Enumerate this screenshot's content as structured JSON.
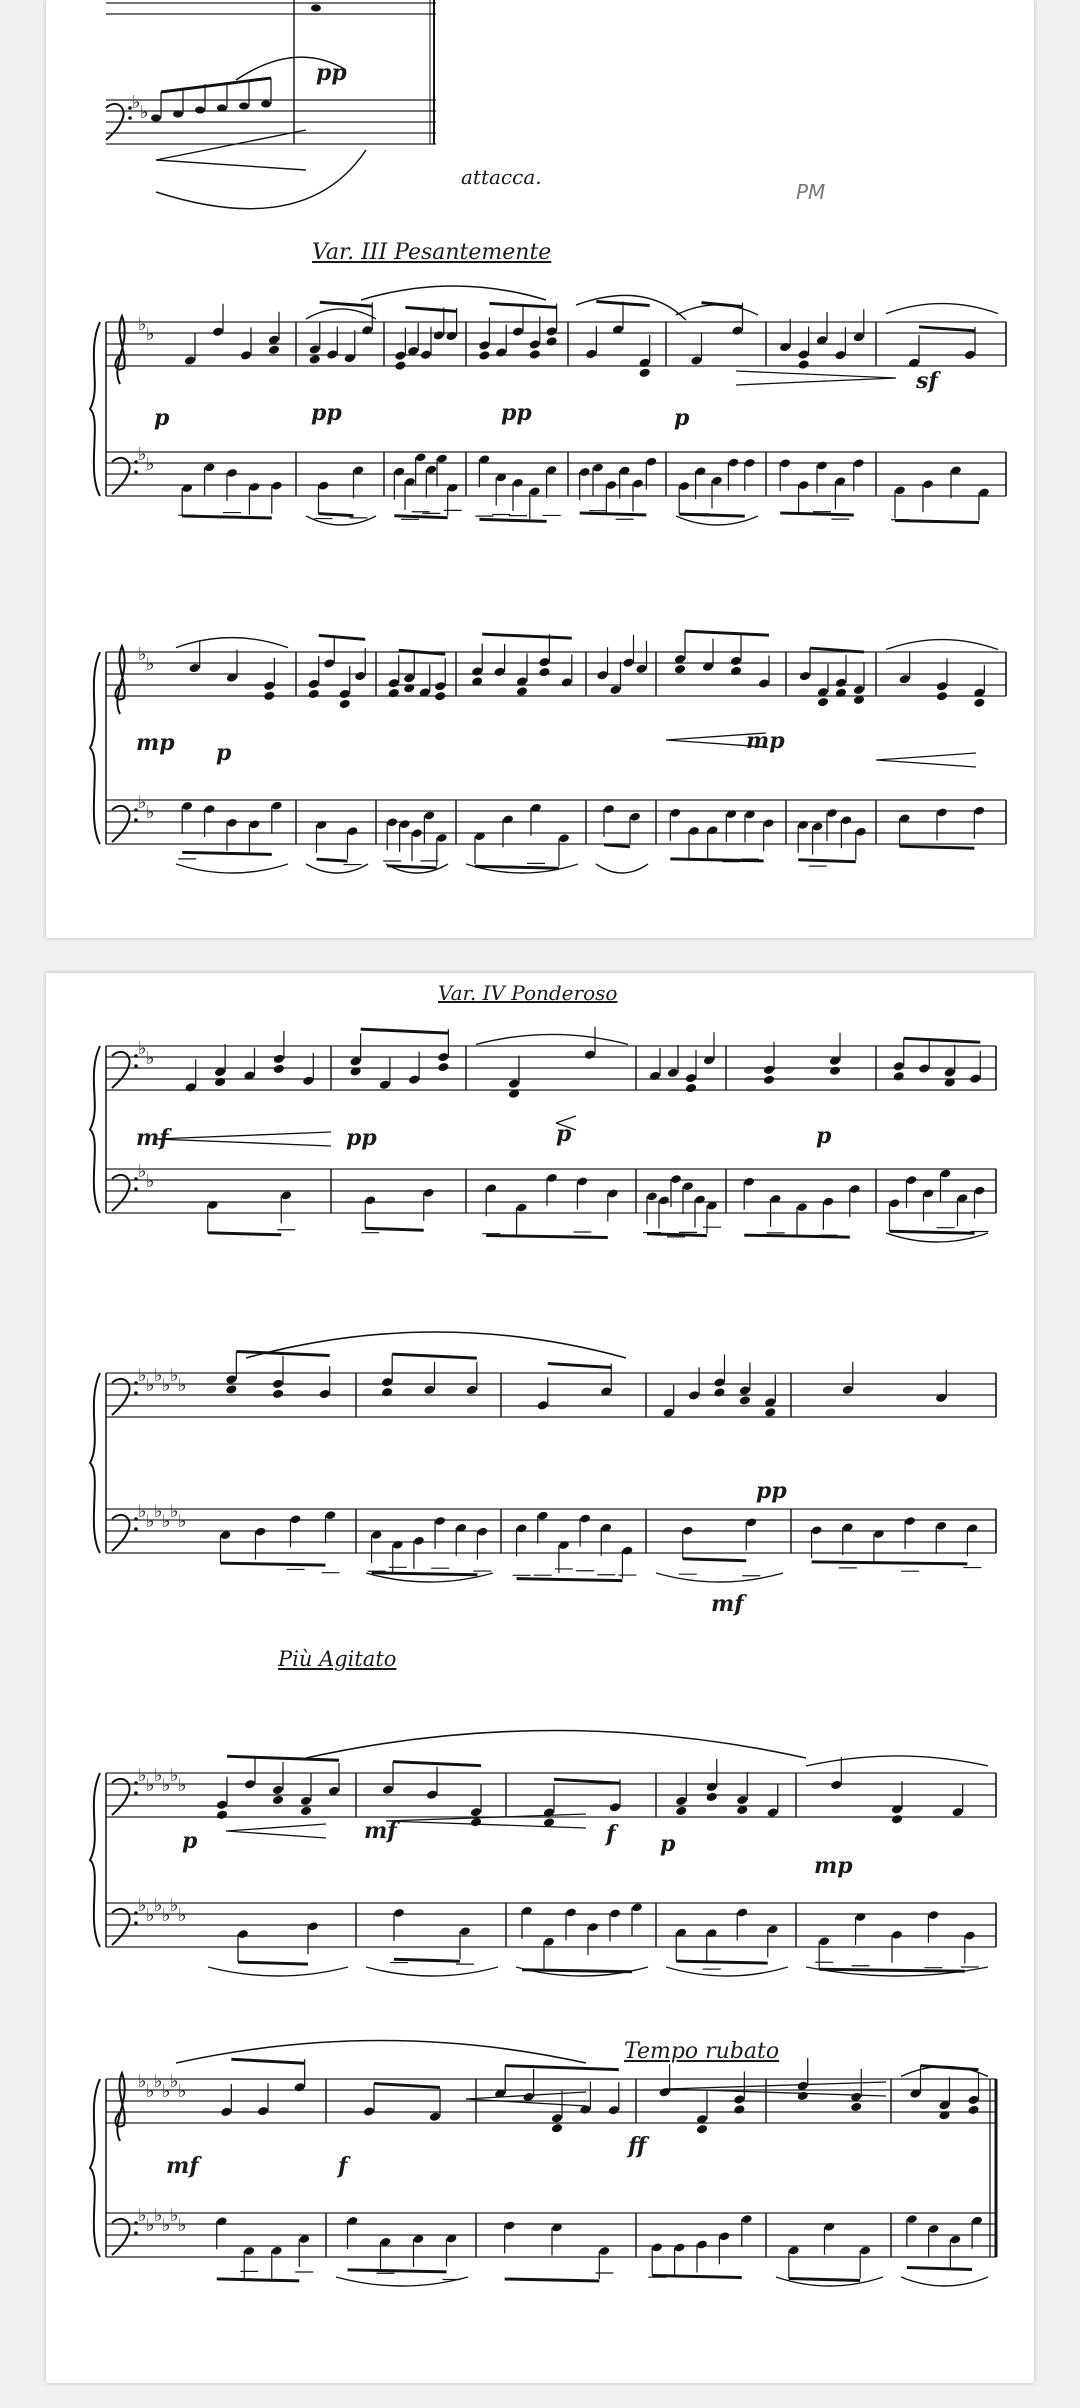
{
  "pages": [
    {
      "id": "page-1",
      "markings": {
        "attacca": "attacca.",
        "variation_title": "Var. III  Pesantemente",
        "corner_mark": "PM",
        "dynamics": [
          "pp",
          "pp",
          "p",
          "pp",
          "p",
          "sf",
          "mp",
          "p",
          "mp"
        ]
      }
    },
    {
      "id": "page-2",
      "markings": {
        "variation_title": "Var. IV  Ponderoso",
        "section_two": "Più Agitato",
        "section_three": "Tempo rubato",
        "dynamics": [
          "mf",
          "pp",
          "p",
          "p",
          "pp",
          "mf",
          "p",
          "mf",
          "f",
          "p",
          "mp",
          "mf",
          "f",
          "ff"
        ]
      }
    }
  ]
}
